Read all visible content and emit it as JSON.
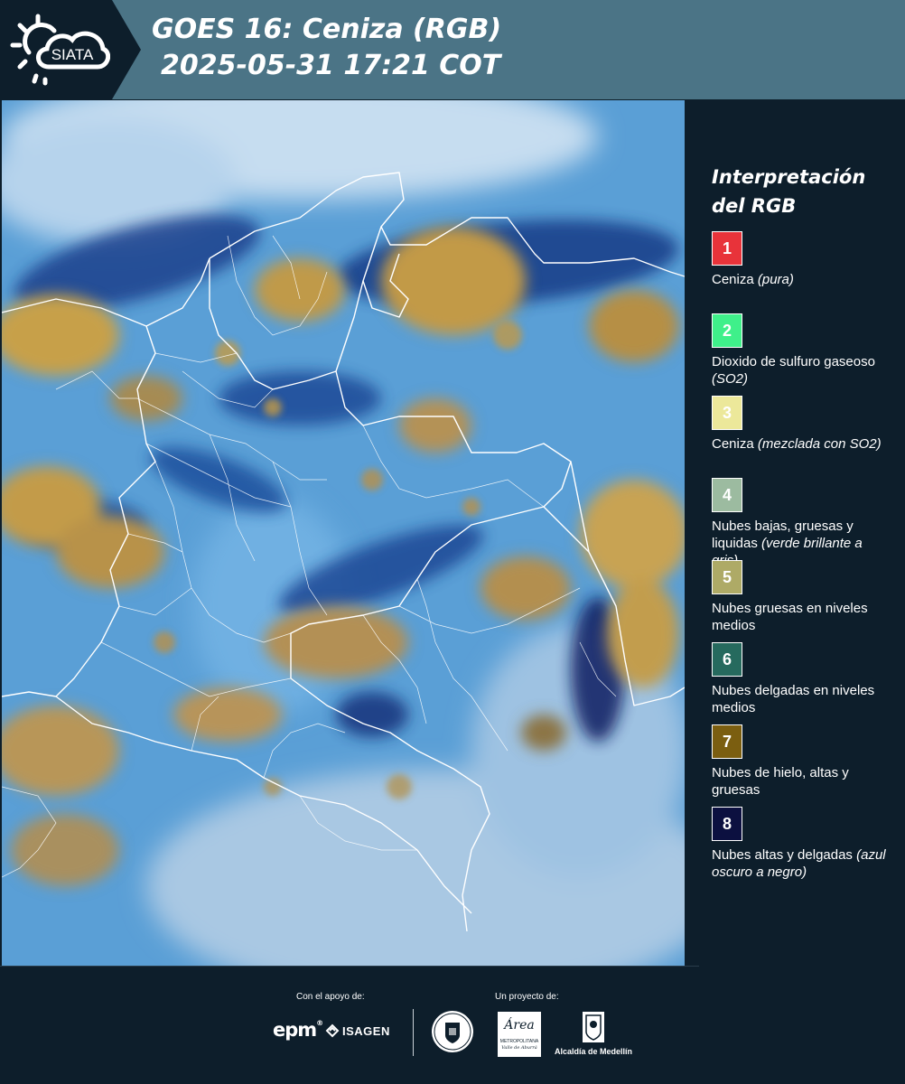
{
  "header": {
    "logo_text": "SIATA",
    "title": "GOES 16: Ceniza (RGB)",
    "subtitle": "2025-05-31 17:21 COT"
  },
  "legend": {
    "title_line1": "Interpretación",
    "title_line2": "del RGB",
    "items": [
      {
        "number": "1",
        "color": "#e8333a",
        "text_color": "#ffffff",
        "label": "Ceniza",
        "note": "(pura)"
      },
      {
        "number": "2",
        "color": "#3ff08a",
        "text_color": "#ffffff",
        "label": "Dioxido de sulfuro gaseoso",
        "note": "(SO2)"
      },
      {
        "number": "3",
        "color": "#ece89a",
        "text_color": "#ffffff",
        "label": "Ceniza",
        "note": "(mezclada con SO2)"
      },
      {
        "number": "4",
        "color": "#9cbba0",
        "text_color": "#ffffff",
        "label": "Nubes bajas, gruesas y liquidas",
        "note": "(verde brillante a gris)"
      },
      {
        "number": "5",
        "color": "#aeaa66",
        "text_color": "#ffffff",
        "label": "Nubes gruesas en niveles medios",
        "note": ""
      },
      {
        "number": "6",
        "color": "#266a5e",
        "text_color": "#ffffff",
        "label": "Nubes delgadas en niveles medios",
        "note": ""
      },
      {
        "number": "7",
        "color": "#7b5e10",
        "text_color": "#ffffff",
        "label": "Nubes de hielo, altas y gruesas",
        "note": ""
      },
      {
        "number": "8",
        "color": "#0c1040",
        "text_color": "#ffffff",
        "label": "Nubes altas y delgadas",
        "note": "(azul oscuro a negro)"
      }
    ]
  },
  "footer": {
    "support_label": "Con el apoyo de:",
    "project_label": "Un proyecto de:",
    "epm": "epm",
    "isagen": "ISAGEN",
    "metropolitana_logo": "Área",
    "metropolitana": "METROPOLITANA",
    "metropolitana_sub": "Valle de Aburrá",
    "alcaldia": "Alcaldía de Medellín"
  }
}
